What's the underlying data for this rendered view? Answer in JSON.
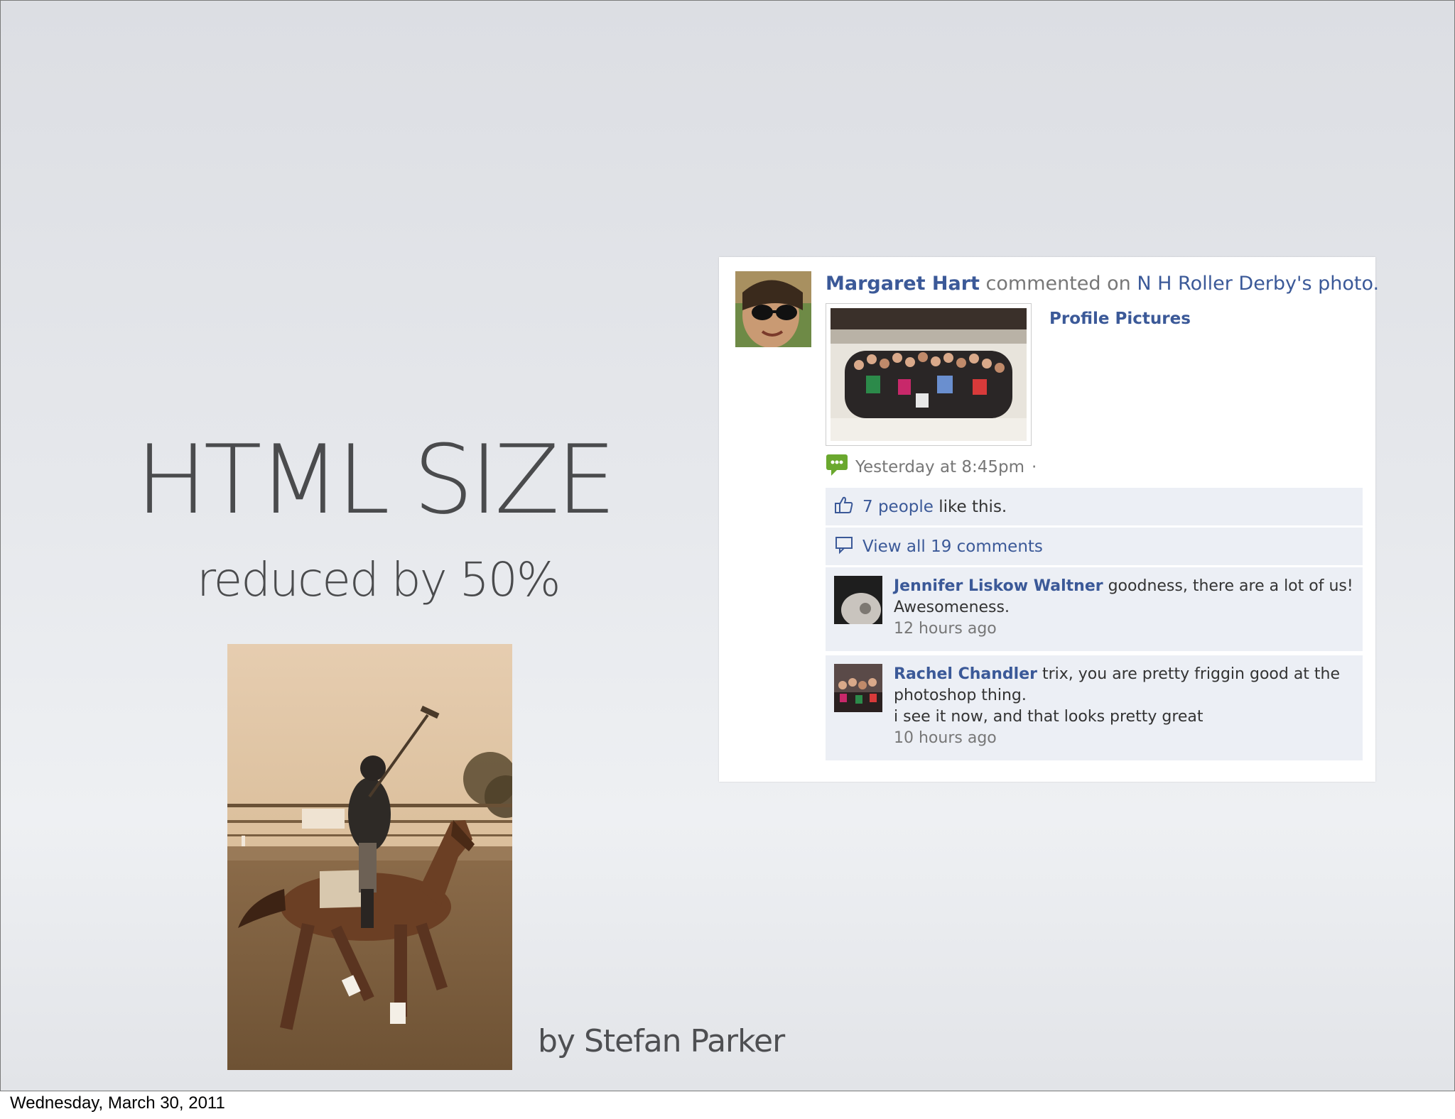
{
  "slide": {
    "title": "HTML SIZE",
    "subtitle": "reduced by 50%",
    "byline": "by Stefan Parker"
  },
  "footer": {
    "date": "Wednesday, March 30, 2011"
  },
  "facebook_story": {
    "actor": "Margaret Hart",
    "verb": "commented on",
    "target": "N H Roller Derby's photo.",
    "album": "Profile Pictures",
    "timestamp": "Yesterday at 8:45pm",
    "separator": "·",
    "likes_link": "7 people",
    "likes_suffix": "like this.",
    "view_comments": "View all 19 comments",
    "comments": [
      {
        "author": "Jennifer Liskow Waltner",
        "text": "goodness, there are a lot of us! Awesomeness.",
        "time": "12 hours ago"
      },
      {
        "author": "Rachel Chandler",
        "text": "trix, you are pretty friggin good at the photoshop thing.",
        "text2": "i see it now, and that looks pretty great",
        "time": "10 hours ago"
      }
    ]
  },
  "icons": {
    "story_icon": "comment-bubble-icon",
    "like_icon": "thumbs-up-icon",
    "comments_icon": "speech-bubble-icon"
  },
  "colors": {
    "link": "#3b5998",
    "muted": "#777777",
    "ufi_bg": "#eceff5",
    "title": "#4a4b4d"
  }
}
